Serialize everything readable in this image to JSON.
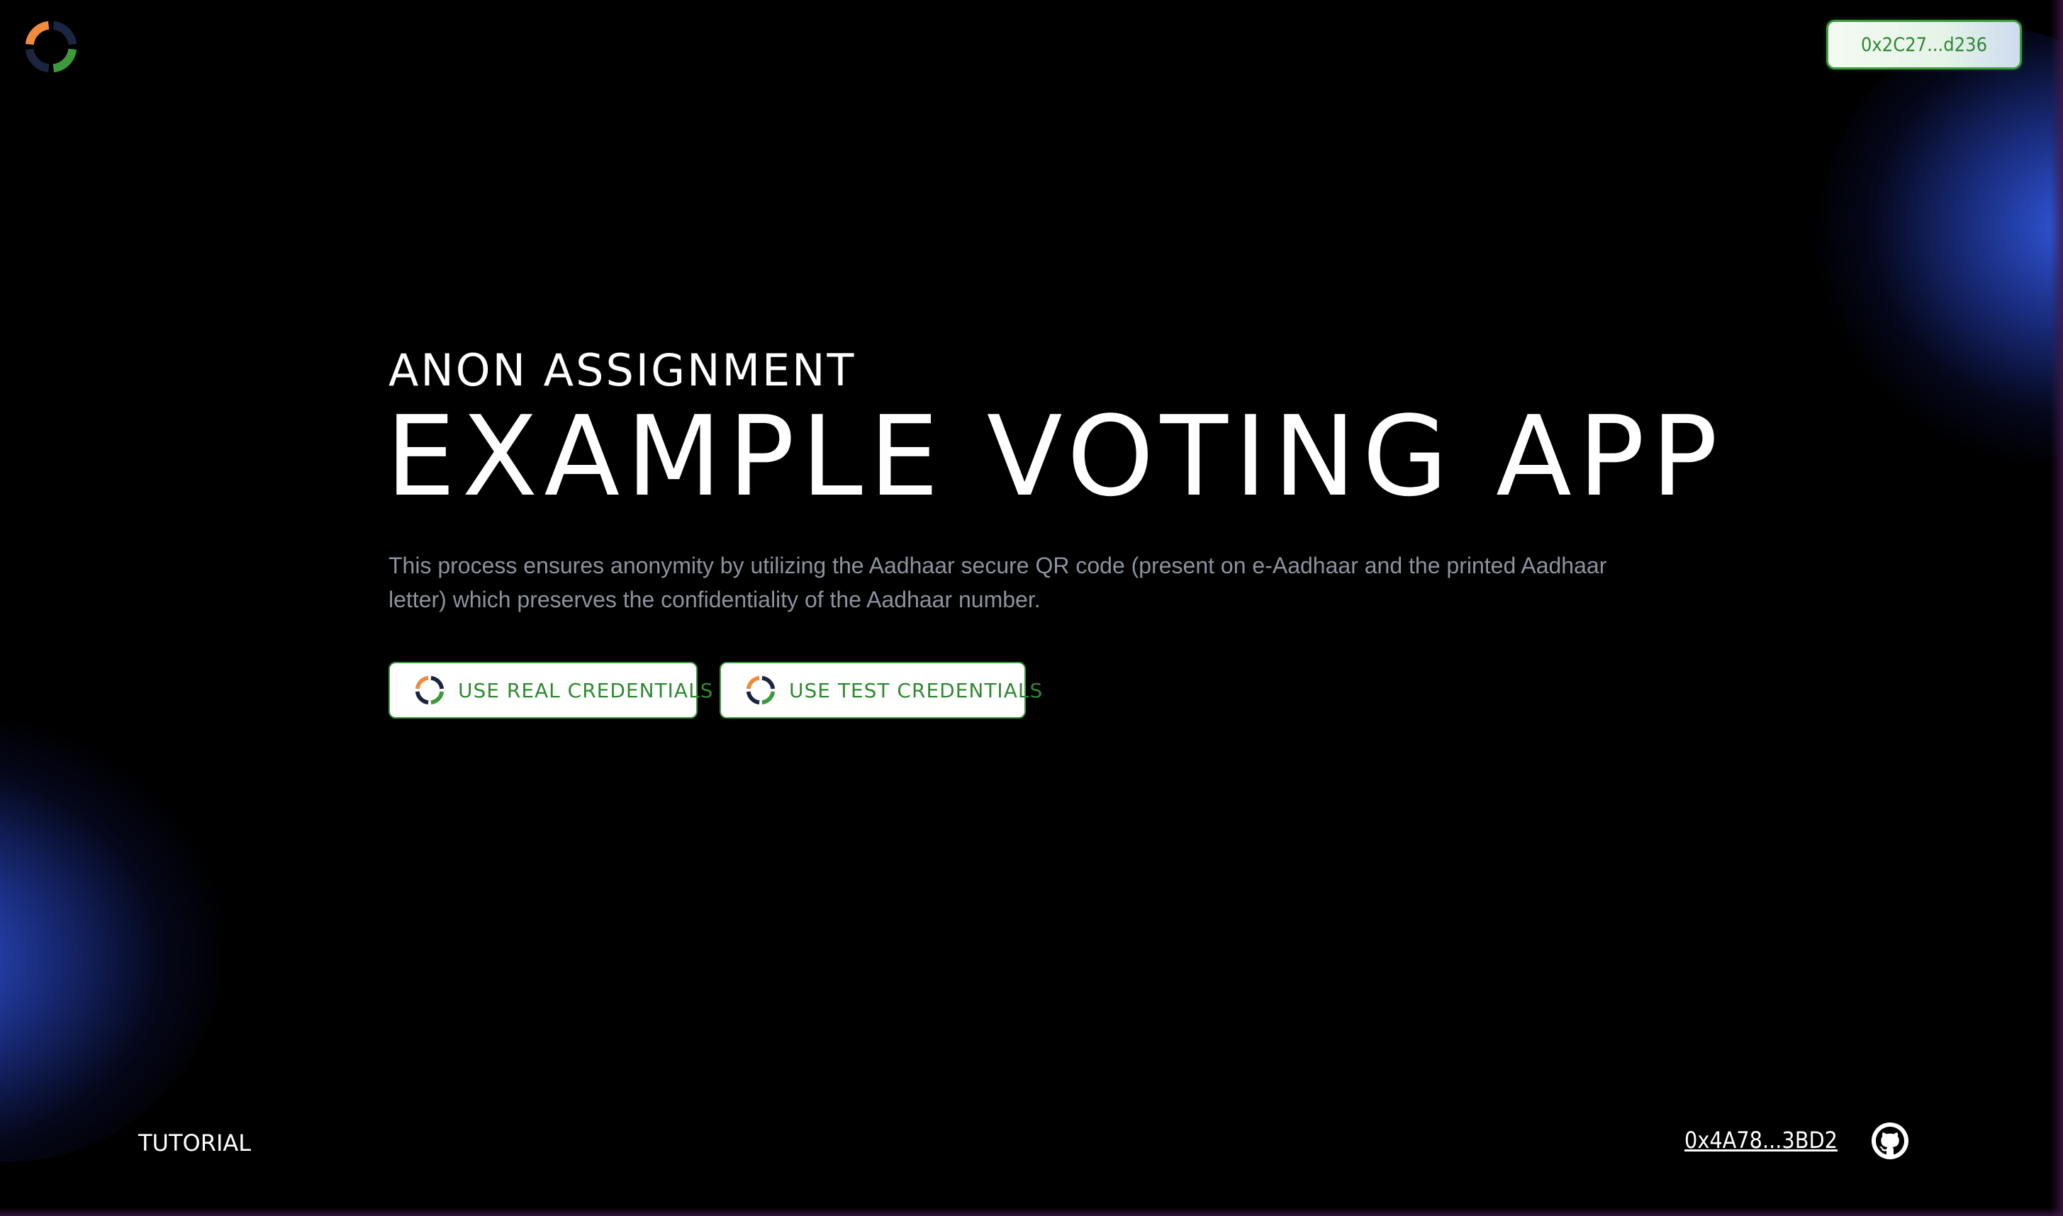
{
  "header": {
    "logo_icon": "anon-aadhaar-ring-icon",
    "wallet_address": "0x2C27...d236"
  },
  "hero": {
    "eyebrow": "ANON ASSIGNMENT",
    "title": "EXAMPLE VOTING APP",
    "description": "This process ensures anonymity by utilizing the Aadhaar secure QR code (present on e-Aadhaar and the printed Aadhaar letter) which preserves the confidentiality of the Aadhaar number.",
    "buttons": [
      {
        "label": "USE REAL CREDENTIALS",
        "icon": "anon-aadhaar-ring-icon"
      },
      {
        "label": "USE TEST CREDENTIALS",
        "icon": "anon-aadhaar-ring-icon"
      }
    ]
  },
  "footer": {
    "tutorial_label": "TUTORIAL",
    "contract_address": "0x4A78...3BD2",
    "github_icon": "github-icon"
  },
  "colors": {
    "background": "#000000",
    "accent_green": "#3e9b3e",
    "glow_blue": "#345ce8",
    "ring_orange": "#f08c3c",
    "ring_navy": "#1b2540",
    "description_gray": "#8d929e"
  }
}
